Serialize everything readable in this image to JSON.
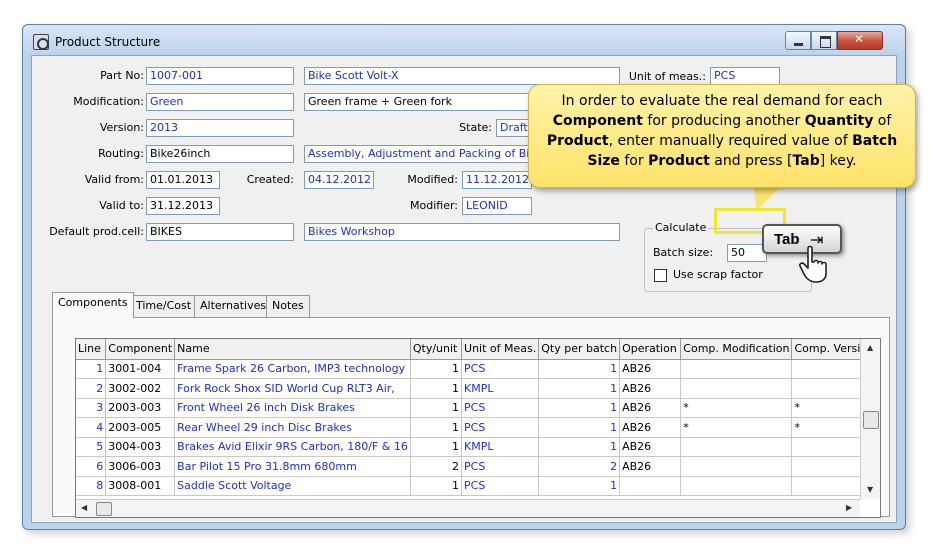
{
  "window": {
    "title": "Product Structure"
  },
  "header": {
    "part_no_label": "Part No:",
    "part_no": "1007-001",
    "part_name": "Bike Scott Volt-X",
    "uom_label": "Unit of meas.:",
    "uom": "PCS",
    "modification_label": "Modification:",
    "modification": "Green",
    "modification_desc": "Green frame + Green fork",
    "version_label": "Version:",
    "version": "2013",
    "state_label": "State:",
    "state": "Draft",
    "routing_label": "Routing:",
    "routing": "Bike26inch",
    "routing_desc": "Assembly, Adjustment and Packing of Bikes",
    "valid_from_label": "Valid from:",
    "valid_from": "01.01.2013",
    "created_label": "Created:",
    "created": "04.12.2012",
    "modified_label": "Modified:",
    "modified": "11.12.2012",
    "valid_to_label": "Valid to:",
    "valid_to": "31.12.2013",
    "modifier_label": "Modifier:",
    "modifier": "LEONID",
    "prod_cell_label": "Default prod.cell:",
    "prod_cell": "BIKES",
    "prod_cell_desc": "Bikes Workshop"
  },
  "calculate": {
    "title": "Calculate",
    "batch_size_label": "Batch size:",
    "batch_size": "50",
    "scrap_label": "Use scrap factor"
  },
  "callout": {
    "p1": "In order to evaluate the real demand for each ",
    "b1": "Component",
    "p2": " for producing another ",
    "b2": "Quantity",
    "p3": " of ",
    "b3": "Product",
    "p4": ", enter manually required value of ",
    "b4": "Batch Size",
    "p5": " for ",
    "b5": "Product",
    "p6": " and press [",
    "b6": "Tab",
    "p7": "] key."
  },
  "tabkey": {
    "label": "Tab",
    "icon": "tab-arrows-icon"
  },
  "tabs": [
    "Components",
    "Time/Cost",
    "Alternatives",
    "Notes"
  ],
  "table": {
    "columns": [
      "Line",
      "Component",
      "Name",
      "Qty/unit",
      "Unit of Meas.",
      "Qty per batch",
      "Operation",
      "Comp. Modification",
      "Comp. Version"
    ],
    "rows": [
      [
        "1",
        "3001-004",
        "Frame Spark 26 Carbon, IMP3 technology",
        "1",
        "PCS",
        "1",
        "AB26",
        "",
        ""
      ],
      [
        "2",
        "3002-002",
        "Fork Rock Shox SID World Cup RLT3 Air,",
        "1",
        "KMPL",
        "1",
        "AB26",
        "",
        ""
      ],
      [
        "3",
        "2003-003",
        "Front Wheel 26 inch Disk Brakes",
        "1",
        "PCS",
        "1",
        "AB26",
        "*",
        "*"
      ],
      [
        "4",
        "2003-005",
        "Rear Wheel 29 inch Disc Brakes",
        "1",
        "PCS",
        "1",
        "AB26",
        "*",
        "*"
      ],
      [
        "5",
        "3004-003",
        "Brakes Avid Elixir 9RS Carbon, 180/F & 16",
        "1",
        "KMPL",
        "1",
        "AB26",
        "",
        ""
      ],
      [
        "6",
        "3006-003",
        "Bar Pilot 15 Pro 31.8mm 680mm",
        "2",
        "PCS",
        "2",
        "AB26",
        "",
        ""
      ],
      [
        "8",
        "3008-001",
        "Saddle Scott Voltage",
        "1",
        "PCS",
        "1",
        "",
        "",
        ""
      ]
    ]
  }
}
